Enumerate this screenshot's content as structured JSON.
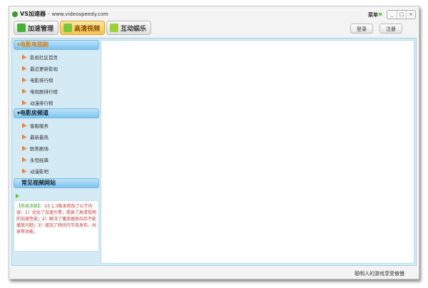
{
  "window": {
    "app_name": "VS加速器",
    "url": "www.videospeedy.com",
    "menu": "菜单",
    "controls": [
      "_",
      "□",
      "×"
    ]
  },
  "tabs": [
    {
      "label": "加速管理",
      "color": "#4cae3a"
    },
    {
      "label": "高清视频",
      "color": "#7cc63a"
    },
    {
      "label": "互动娱乐",
      "color": "#9bd23c"
    }
  ],
  "header": {
    "login": "登录",
    "register": "注册"
  },
  "sidebar": {
    "groups": [
      {
        "label": "电影电视剧",
        "items": [
          "影视社区首页",
          "最近更新影视",
          "电影排行榜",
          "电视剧排行榜",
          "动漫排行榜"
        ]
      },
      {
        "label": "电影房频道",
        "items": [
          "客服服务",
          "最新最热",
          "欧美剧场",
          "永恒经典",
          "动漫影吧"
        ]
      },
      {
        "label": "常见视频网站",
        "items": []
      }
    ]
  },
  "message": {
    "tag": "【系统消息】",
    "text": "：V3.1.3版本修改了以下内容：1）优化了加速引擎，提高了高清视频的加速性能；2）解决了播放器拖拉后不能播放问题；3）增加了频间内节目发布、共享等功能。"
  },
  "status": "聪明人的游戏享受傲慢"
}
